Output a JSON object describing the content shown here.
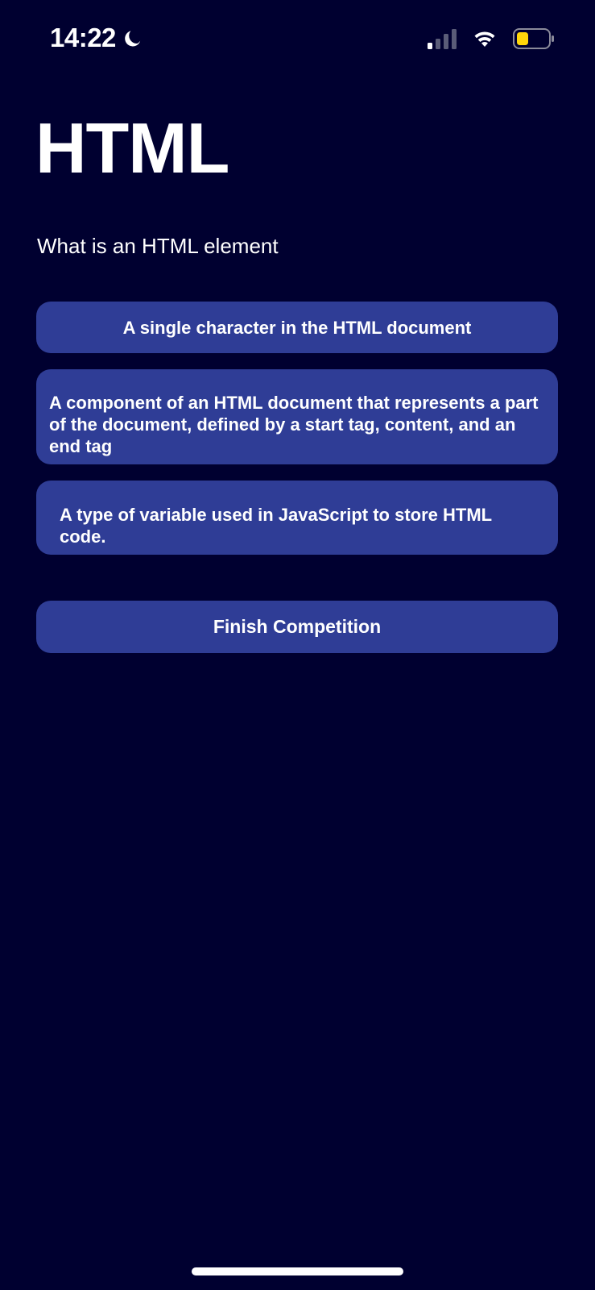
{
  "status_bar": {
    "time": "14:22",
    "icons": [
      "moon-icon",
      "signal-icon",
      "wifi-icon",
      "battery-icon"
    ],
    "battery_color": "#ffd60a"
  },
  "page": {
    "title": "HTML",
    "question": "What is an HTML element"
  },
  "answers": [
    {
      "label": "A single character in the HTML document"
    },
    {
      "label": "A component of an HTML document that represents a part of the document, defined by a start tag, content, and an end tag"
    },
    {
      "label": "A type of variable used in JavaScript to store HTML code."
    }
  ],
  "finish_button": {
    "label": "Finish Competition"
  },
  "colors": {
    "background": "#000030",
    "button": "#2f3d96",
    "text": "#ffffff"
  }
}
